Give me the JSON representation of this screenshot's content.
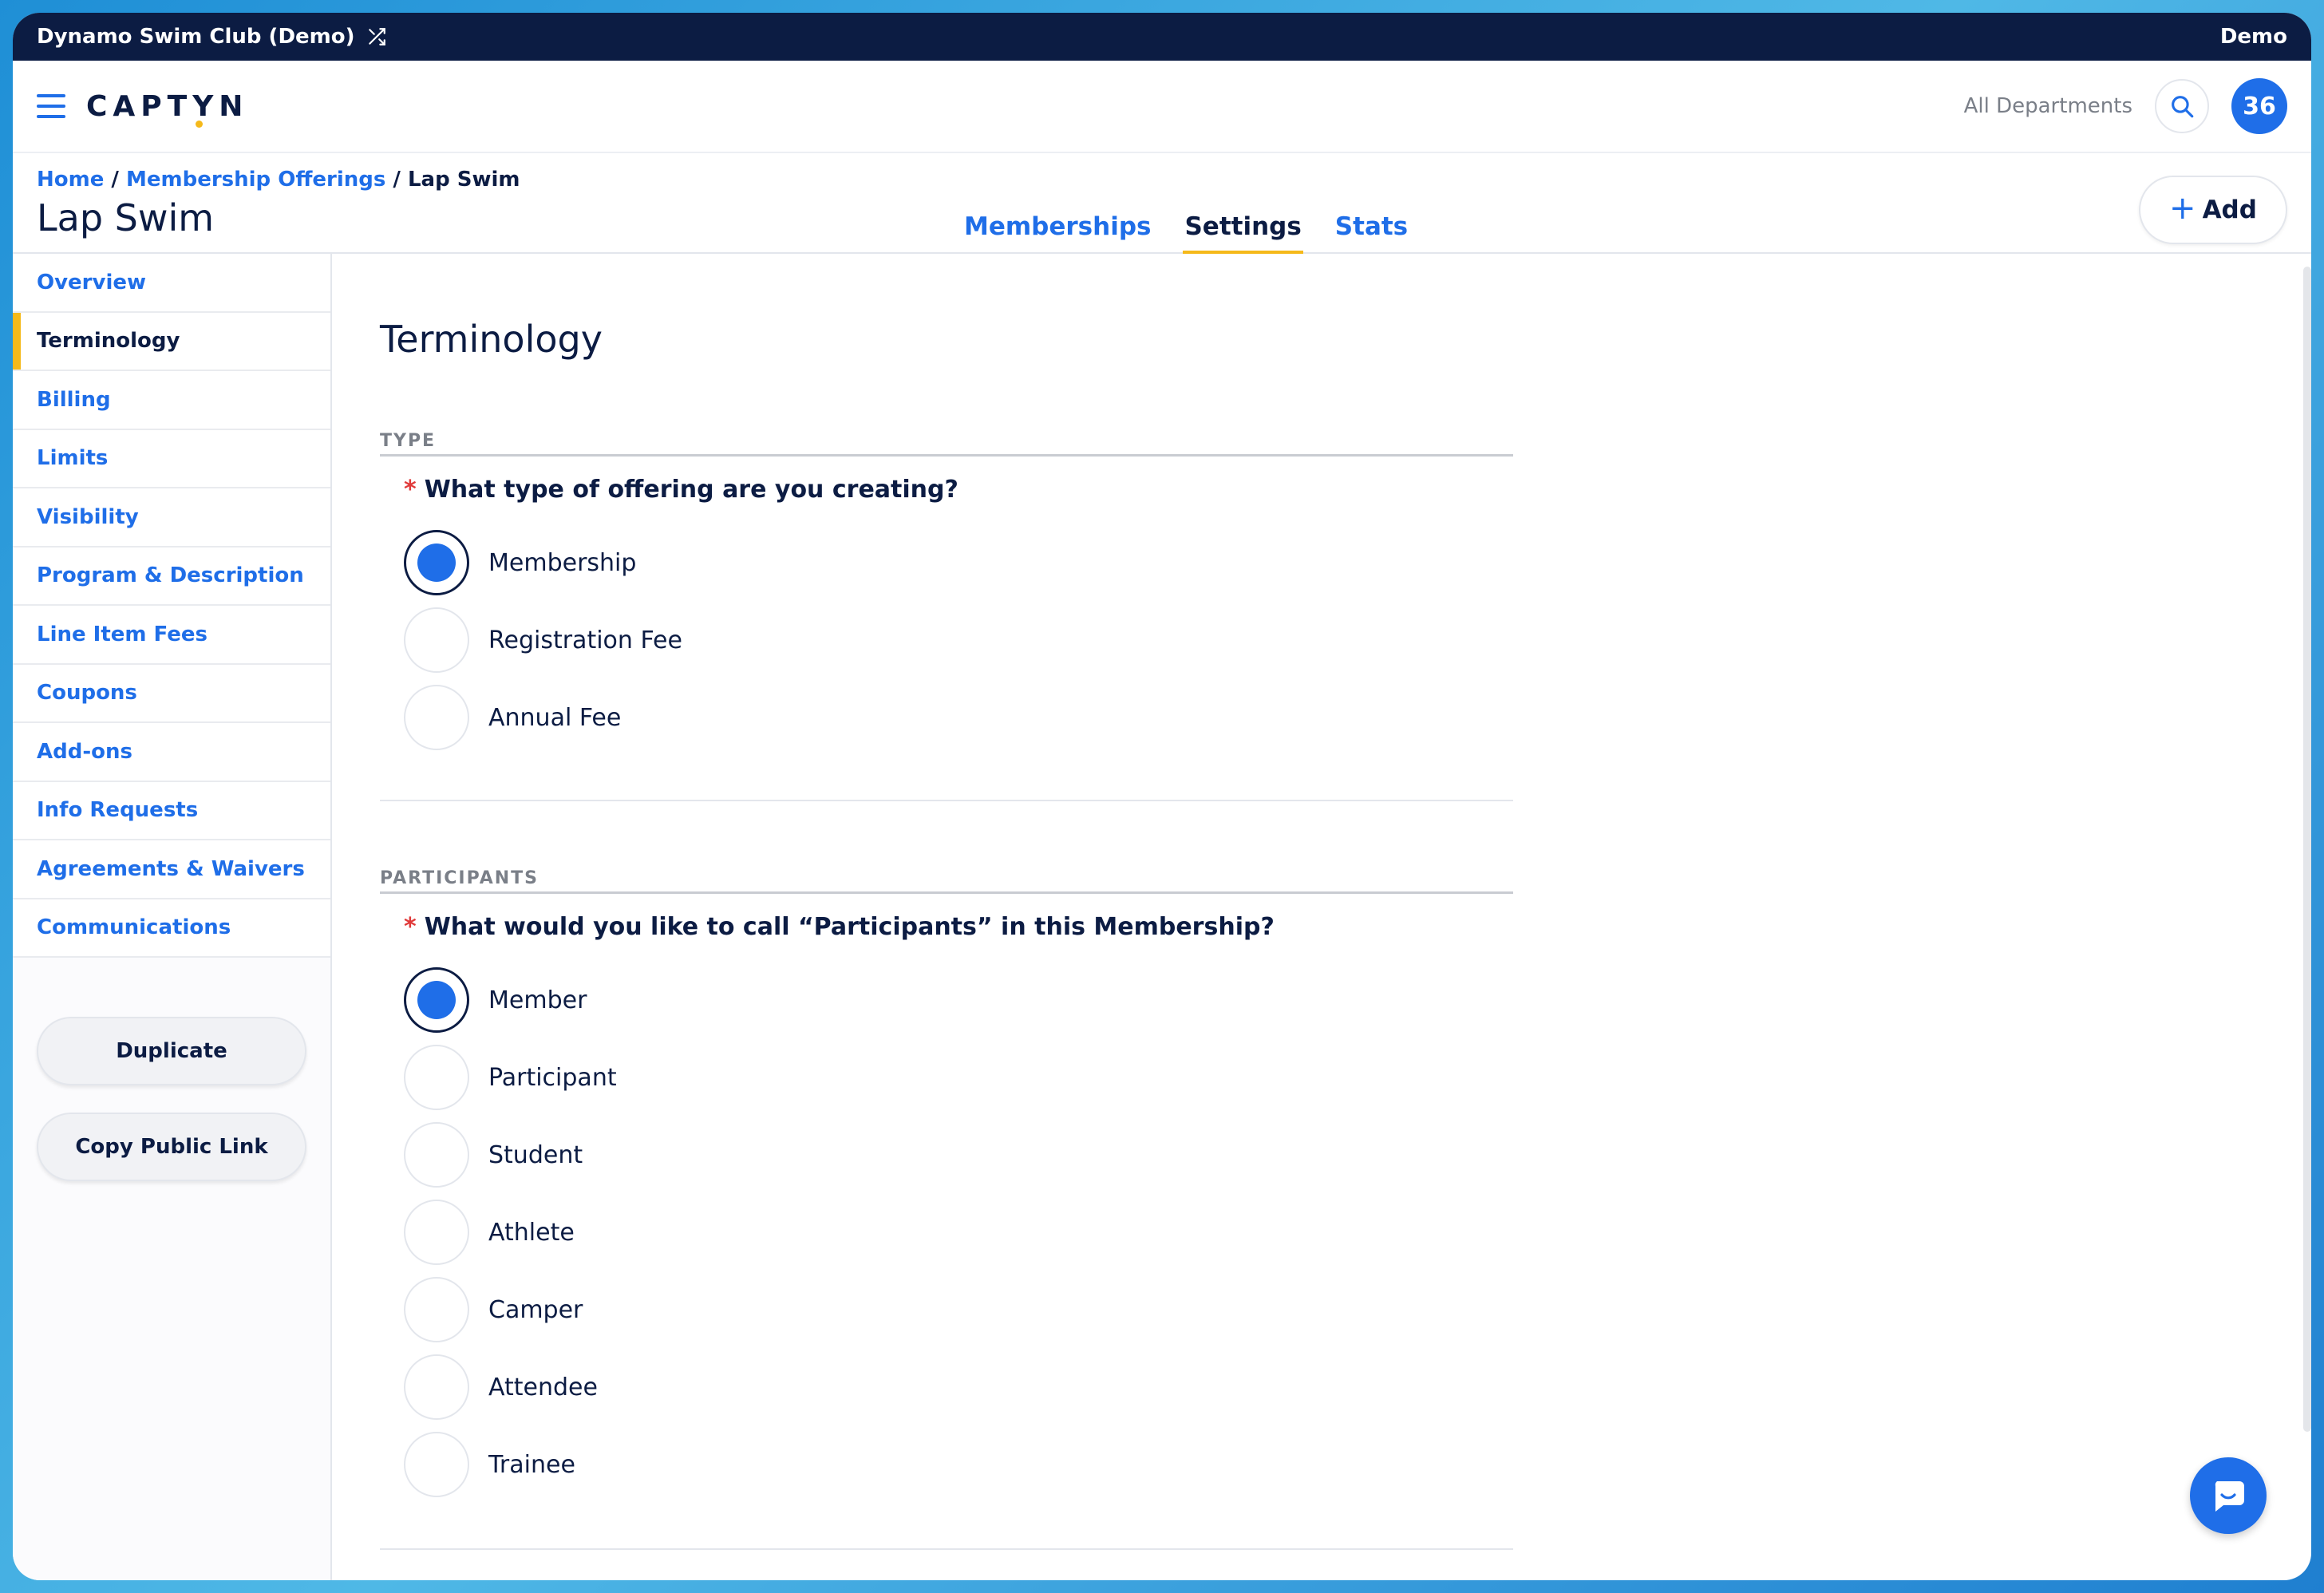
{
  "topbar": {
    "club_name": "Dynamo Swim Club (Demo)",
    "mode": "Demo"
  },
  "header": {
    "logo": "CAPTYN",
    "department": "All Departments",
    "avatar_count": "36"
  },
  "breadcrumb": {
    "home": "Home",
    "separator": "/",
    "offerings": "Membership Offerings",
    "current": "Lap Swim"
  },
  "page": {
    "title": "Lap Swim",
    "add_label": "Add"
  },
  "tabs": [
    {
      "label": "Memberships",
      "active": false
    },
    {
      "label": "Settings",
      "active": true
    },
    {
      "label": "Stats",
      "active": false
    }
  ],
  "sidebar": {
    "items": [
      {
        "label": "Overview"
      },
      {
        "label": "Terminology"
      },
      {
        "label": "Billing"
      },
      {
        "label": "Limits"
      },
      {
        "label": "Visibility"
      },
      {
        "label": "Program & Description"
      },
      {
        "label": "Line Item Fees"
      },
      {
        "label": "Coupons"
      },
      {
        "label": "Add-ons"
      },
      {
        "label": "Info Requests"
      },
      {
        "label": "Agreements & Waivers"
      },
      {
        "label": "Communications"
      }
    ],
    "active_item": "Terminology",
    "duplicate_label": "Duplicate",
    "copy_link_label": "Copy Public Link"
  },
  "main": {
    "section_title": "Terminology",
    "type_group": {
      "label": "TYPE",
      "required_mark": "*",
      "question": "What type of offering are you creating?",
      "options": [
        "Membership",
        "Registration Fee",
        "Annual Fee"
      ],
      "selected": "Membership"
    },
    "participants_group": {
      "label": "PARTICIPANTS",
      "required_mark": "*",
      "question": "What would you like to call “Participants” in this Membership?",
      "options": [
        "Member",
        "Participant",
        "Student",
        "Athlete",
        "Camper",
        "Attendee",
        "Trainee"
      ],
      "selected": "Member"
    }
  },
  "colors": {
    "brand_dark": "#0c1c43",
    "accent_blue": "#1f6ee8",
    "accent_yellow": "#f5b91a"
  }
}
